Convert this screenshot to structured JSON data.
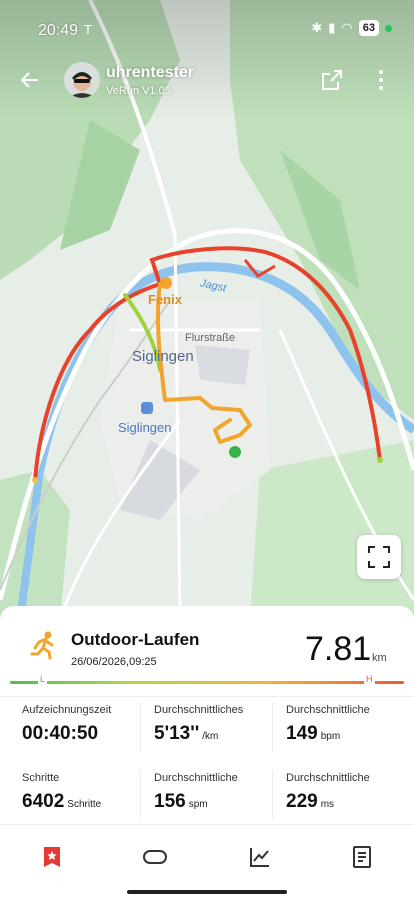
{
  "status": {
    "time": "20:49",
    "carrier_icon": "T",
    "battery": "63"
  },
  "header": {
    "username": "uhrentester",
    "subtitle": "VeRun  V1.05"
  },
  "map": {
    "labels": {
      "fenix": "Fenix",
      "jagst": "Jagst",
      "flurstrasse": "Flurstraße",
      "siglingen_town": "Siglingen",
      "siglingen_station": "Siglingen"
    }
  },
  "activity": {
    "title": "Outdoor-Laufen",
    "date": "26/06/2026,09:25",
    "distance": "7.81",
    "distance_unit": "km",
    "scale_low": "L",
    "scale_high": "H",
    "stats": [
      {
        "label": "Aufzeichnungszeit",
        "value": "00:40:50",
        "unit": ""
      },
      {
        "label": "Durchschnittliches",
        "value": "5'13''",
        "unit": "/km"
      },
      {
        "label": "Durchschnittliche",
        "value": "149",
        "unit": "bpm"
      },
      {
        "label": "Schritte",
        "value": "6402",
        "unit": "Schritte"
      },
      {
        "label": "Durchschnittliche",
        "value": "156",
        "unit": "spm"
      },
      {
        "label": "Durchschnittliche",
        "value": "229",
        "unit": "ms"
      }
    ]
  },
  "colors": {
    "accent_orange": "#f2a52c",
    "route_red": "#e8432a",
    "route_green": "#9fd23a",
    "nav_active": "#e53935"
  },
  "nav": [
    "star-bookmark",
    "device",
    "chart",
    "document"
  ]
}
